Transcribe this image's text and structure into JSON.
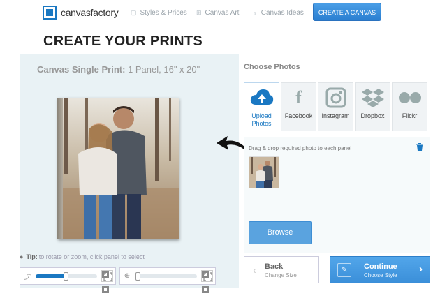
{
  "header": {
    "logo_text": "canvasfactory",
    "nav": [
      {
        "label": "Styles & Prices",
        "icon": "styles-icon"
      },
      {
        "label": "Canvas Art",
        "icon": "grid-icon"
      },
      {
        "label": "Canvas Ideas",
        "icon": "lightbulb-icon"
      }
    ],
    "cta_label": "CREATE A CANVAS"
  },
  "page_title": "CREATE YOUR PRINTS",
  "print": {
    "type_label": "Canvas Single Print:",
    "spec": "1 Panel, 16\" x 20\""
  },
  "tip": {
    "label": "Tip:",
    "text": "to rotate or zoom, click panel to select"
  },
  "controls": {
    "rotate_level": 0.5,
    "zoom_level": 0.05
  },
  "photos_panel": {
    "title": "Choose Photos",
    "sources": [
      {
        "label": "Upload Photos",
        "icon": "cloud-upload-icon",
        "active": true
      },
      {
        "label": "Facebook",
        "icon": "facebook-icon"
      },
      {
        "label": "Instagram",
        "icon": "instagram-icon"
      },
      {
        "label": "Dropbox",
        "icon": "dropbox-icon"
      },
      {
        "label": "Flickr",
        "icon": "flickr-icon"
      }
    ],
    "drop_text": "Drag & drop required photo to each panel",
    "browse_label": "Browse"
  },
  "footer_nav": {
    "back_label": "Back",
    "back_sub": "Change Size",
    "continue_label": "Continue",
    "continue_sub": "Choose Style"
  },
  "colors": {
    "brand_blue": "#1a78c2",
    "button_blue": "#4a9ee6",
    "workspace_bg": "#e9f2f5"
  }
}
